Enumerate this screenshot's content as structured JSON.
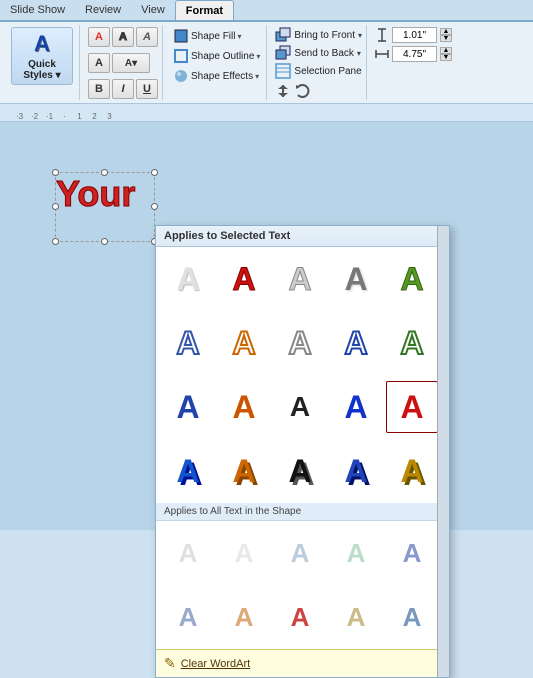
{
  "tabs": {
    "items": [
      {
        "label": "Slide Show",
        "active": false
      },
      {
        "label": "Review",
        "active": false
      },
      {
        "label": "View",
        "active": false
      },
      {
        "label": "Format",
        "active": true
      }
    ]
  },
  "ribbon": {
    "quick_styles_label": "Quick\nStyles",
    "shape_fill": "Shape Fill",
    "shape_outline": "Shape Outline",
    "shape_effects": "Shape Effects",
    "bring_to_front": "Bring to Front",
    "send_to_back": "Send to Back",
    "selection_pane": "Selection Pane",
    "height_value": "1.01\"",
    "width_value": "4.75\""
  },
  "popup": {
    "header": "Applies to Selected Text",
    "section2_label": "Applies to All Text in the Shape",
    "clear_label": "Clear WordArt",
    "styles_row1": [
      {
        "id": "wa1",
        "class": "wa-plain",
        "label": "plain white"
      },
      {
        "id": "wa2",
        "class": "wa-red",
        "label": "red fill"
      },
      {
        "id": "wa3",
        "class": "wa-plain",
        "label": "light gray"
      },
      {
        "id": "wa4",
        "class": "wa-silver",
        "label": "silver"
      },
      {
        "id": "wa5",
        "class": "wa-green",
        "label": "green"
      }
    ],
    "styles_row2": [
      {
        "id": "wa6",
        "class": "wa-blue-outline",
        "label": "blue outline"
      },
      {
        "id": "wa7",
        "class": "wa-orange-outline",
        "label": "orange outline"
      },
      {
        "id": "wa8",
        "class": "wa-silver-outline",
        "label": "silver outline"
      },
      {
        "id": "wa9",
        "class": "wa-blue2-outline",
        "label": "blue2 outline"
      },
      {
        "id": "wa10",
        "class": "wa-green-outline",
        "label": "green outline"
      }
    ],
    "styles_row3": [
      {
        "id": "wa11",
        "class": "wa-blue-grad",
        "label": "blue gradient"
      },
      {
        "id": "wa12",
        "class": "wa-orange-grad",
        "label": "orange gradient"
      },
      {
        "id": "wa13",
        "class": "wa-dark",
        "label": "dark"
      },
      {
        "id": "wa14",
        "class": "wa-blue3",
        "label": "blue3"
      },
      {
        "id": "wa15",
        "class": "wa-dark-red",
        "label": "dark red"
      }
    ],
    "styles_row4": [
      {
        "id": "wa16",
        "class": "wa-blue-3d",
        "label": "blue 3d"
      },
      {
        "id": "wa17",
        "class": "wa-orange-3d",
        "label": "orange 3d"
      },
      {
        "id": "wa18",
        "class": "wa-black-3d",
        "label": "black 3d"
      },
      {
        "id": "wa19",
        "class": "wa-blue4-3d",
        "label": "blue4 3d"
      },
      {
        "id": "wa20",
        "class": "wa-gold-3d",
        "label": "gold 3d"
      }
    ],
    "section2_styles_row1": [
      {
        "id": "wa21",
        "class": "wa-sm-plain",
        "label": "sm plain"
      },
      {
        "id": "wa22",
        "class": "wa-sm-light1",
        "label": "sm light1"
      },
      {
        "id": "wa23",
        "class": "wa-sm-light2",
        "label": "sm light2"
      },
      {
        "id": "wa24",
        "class": "wa-sm-light3",
        "label": "sm light3"
      },
      {
        "id": "wa25",
        "class": "wa-sm-blue-light",
        "label": "sm blue light"
      }
    ],
    "section2_styles_row2": [
      {
        "id": "wa26",
        "class": "wa-sm-blue-flat",
        "label": "sm blue flat"
      },
      {
        "id": "wa27",
        "class": "wa-sm-orange-flat",
        "label": "sm orange flat"
      },
      {
        "id": "wa28",
        "class": "wa-sm-red-flat",
        "label": "sm red flat"
      },
      {
        "id": "wa29",
        "class": "wa-sm-tan-flat",
        "label": "sm tan flat"
      },
      {
        "id": "wa30",
        "class": "wa-sm-blue2-flat",
        "label": "sm blue2 flat"
      }
    ]
  },
  "wordart": {
    "text": "Your"
  }
}
